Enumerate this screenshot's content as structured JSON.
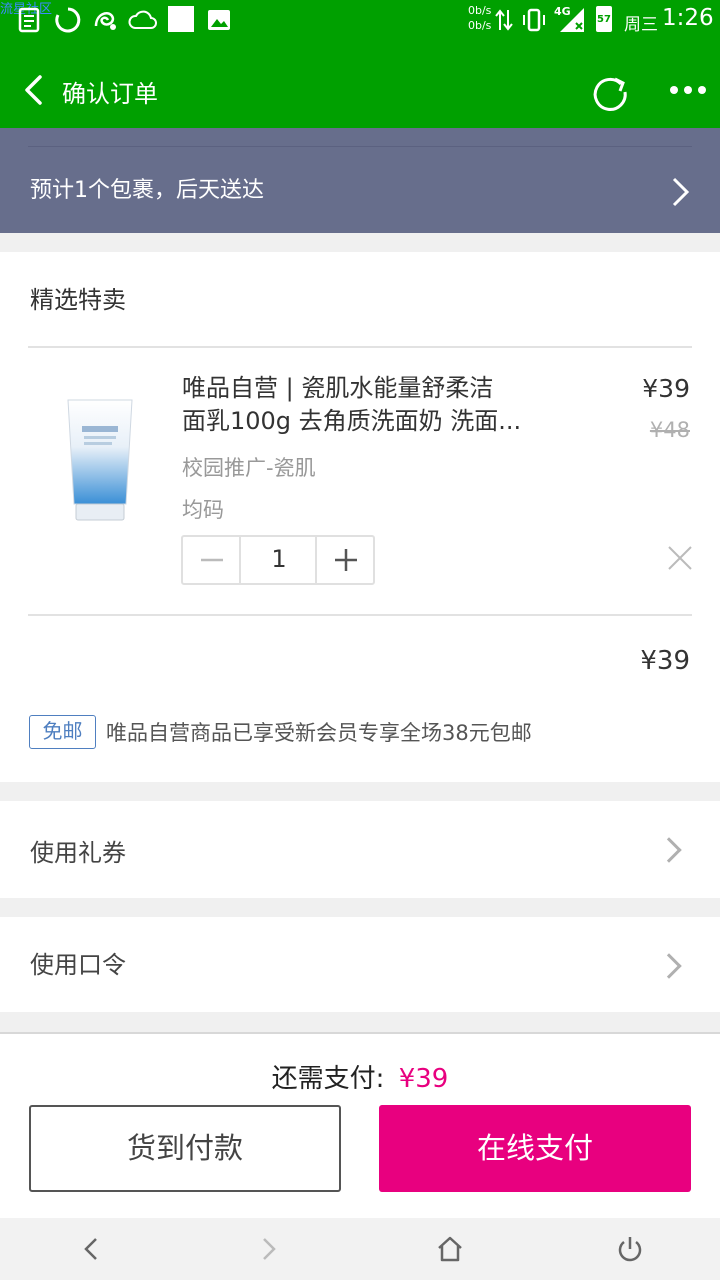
{
  "status_bar": {
    "watermark": "流星社区",
    "net_speed_up": "0b/s",
    "net_speed_down": "0b/s",
    "network": "4G",
    "battery": "57",
    "weekday": "周三",
    "time": "1:26"
  },
  "app_bar": {
    "title": "确认订单"
  },
  "delivery": {
    "text": "预计1个包裹，后天送达"
  },
  "order": {
    "section_title": "精选特卖",
    "product": {
      "name_line1": "唯品自营 | 瓷肌水能量舒柔洁",
      "name_line2": "面乳100g 去角质洗面奶 洗面...",
      "tag": "校园推广-瓷肌",
      "spec": "均码",
      "price": "¥39",
      "original_price": "¥48",
      "quantity": "1"
    },
    "subtotal": "¥39",
    "shipping_badge": "免邮",
    "shipping_text": "唯品自营商品已享受新会员专享全场38元包邮"
  },
  "options": {
    "coupon": "使用礼券",
    "code": "使用口令"
  },
  "payment": {
    "due_label": "还需支付:",
    "due_amount": "¥39",
    "cod_label": "货到付款",
    "online_label": "在线支付"
  },
  "colors": {
    "brand_green": "#00a000",
    "accent_pink": "#e8007f",
    "banner": "#676e8c"
  }
}
